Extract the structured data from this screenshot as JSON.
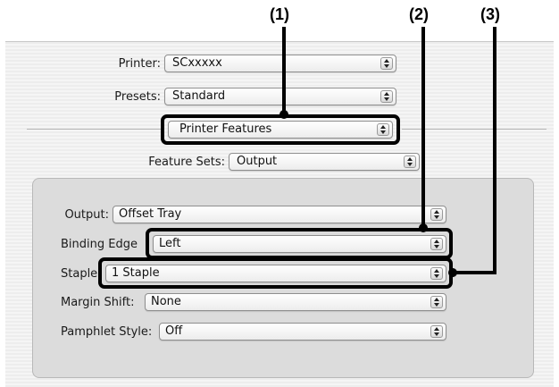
{
  "callouts": [
    "(1)",
    "(2)",
    "(3)"
  ],
  "printer": {
    "label": "Printer:",
    "value": "SCxxxxx"
  },
  "presets": {
    "label": "Presets:",
    "value": "Standard"
  },
  "panel": {
    "value": "Printer Features"
  },
  "feature_sets": {
    "label": "Feature Sets:",
    "value": "Output"
  },
  "output": {
    "label": "Output:",
    "value": "Offset Tray"
  },
  "binding_edge": {
    "label": "Binding Edge",
    "value": "Left"
  },
  "staple": {
    "label": "Staple",
    "value": "1 Staple"
  },
  "margin_shift": {
    "label": "Margin Shift:",
    "value": "None"
  },
  "pamphlet_style": {
    "label": "Pamphlet Style:",
    "value": "Off"
  },
  "icons": {
    "popup_arrows": "up-down-arrows-icon"
  },
  "colors": {
    "callout": "#000000",
    "dialog_bg": "#f0f0f0",
    "inner_panel_bg": "#dcdcdc"
  }
}
